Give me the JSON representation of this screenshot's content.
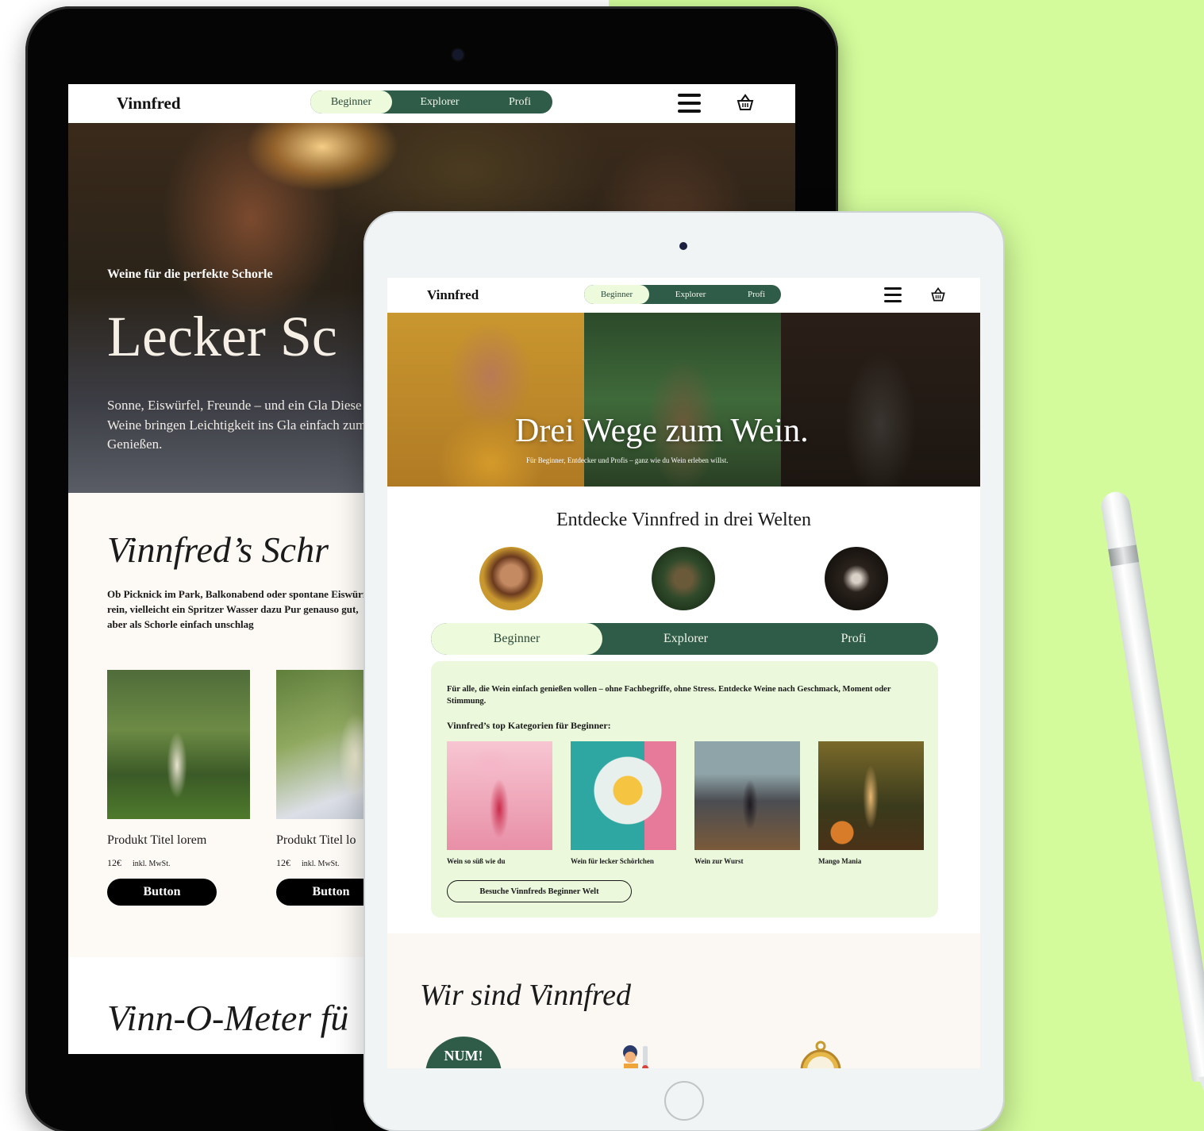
{
  "back_tablet": {
    "nav": {
      "logo": "Vinnfred",
      "tabs": [
        "Beginner",
        "Explorer",
        "Profi"
      ],
      "active_tab": "Beginner"
    },
    "hero": {
      "kicker": "Weine für die perfekte Schorle",
      "title": "Lecker Sc",
      "description": "Sonne, Eiswürfel, Freunde – und ein Gla Diese Weine bringen Leichtigkeit ins Gla einfach zum Genießen."
    },
    "section": {
      "title": "Vinnfred’s Schr",
      "text": "Ob Picknick im Park, Balkonabend oder spontane Eiswürfel rein, vielleicht ein Spritzer Wasser dazu Pur genauso gut, aber als Schorle einfach unschlag"
    },
    "products": [
      {
        "title": "Produkt Titel lorem",
        "price": "12€",
        "tax": "inkl. MwSt.",
        "button": "Button"
      },
      {
        "title": "Produkt Titel lo",
        "price": "12€",
        "tax": "inkl. MwSt.",
        "button": "Button"
      }
    ],
    "next_section_title": "Vinn-O-Meter fü"
  },
  "front_tablet": {
    "nav": {
      "logo": "Vinnfred",
      "tabs": [
        "Beginner",
        "Explorer",
        "Profi"
      ],
      "active_tab": "Beginner"
    },
    "hero": {
      "title": "Drei Wege zum Wein.",
      "subtitle": "Für Beginner, Entdecker und Profis – ganz wie du Wein erleben willst."
    },
    "worlds": {
      "title": "Entdecke Vinnfred in drei Welten",
      "tabs": [
        "Beginner",
        "Explorer",
        "Profi"
      ],
      "active_tab": "Beginner"
    },
    "panel": {
      "intro": "Für alle, die Wein einfach genießen wollen – ohne Fachbegriffe, ohne Stress. Entdecke Weine nach Geschmack, Moment oder Stimmung.",
      "categories_title": "Vinnfred’s top Kategorien für Beginner:",
      "categories": [
        "Wein so süß wie du",
        "Wein für lecker Schörlchen",
        "Wein zur Wurst",
        "Mango Mania"
      ],
      "cta": "Besuche Vinnfreds Beginner Welt"
    },
    "about": {
      "title": "Wir sind Vinnfred",
      "badge_text": "NUM!"
    }
  },
  "colors": {
    "accent_green": "#2f5c48",
    "light_green": "#edfadb",
    "lime_background": "#d3fb9b"
  }
}
